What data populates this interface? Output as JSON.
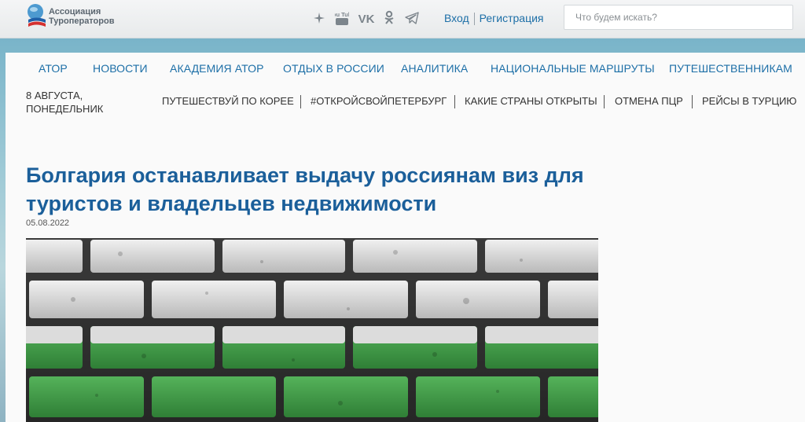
{
  "header": {
    "logo_line1": "Ассоциация",
    "logo_line2": "Туроператоров",
    "social_icons": [
      "star-icon",
      "youtube-icon",
      "vk-icon",
      "odnoklassniki-icon",
      "telegram-icon"
    ],
    "youtube_label": "You Tube",
    "vk_label": "VK",
    "login": "Вход",
    "register": "Регистрация",
    "search_placeholder": "Что будем искать?"
  },
  "nav": {
    "items": [
      "АТОР",
      "НОВОСТИ",
      "АКАДЕМИЯ АТОР",
      "ОТДЫХ В РОССИИ",
      "АНАЛИТИКА",
      "НАЦИОНАЛЬНЫЕ МАРШРУТЫ",
      "ПУТЕШЕСТВЕННИКАМ"
    ]
  },
  "date_block": {
    "line1": "8 АВГУСТА,",
    "line2": "ПОНЕДЕЛЬНИК"
  },
  "tags": [
    "ПУТЕШЕСТВУЙ ПО КОРЕЕ",
    "#ОТКРОЙСВОЙПЕТЕРБУРГ",
    "КАКИЕ СТРАНЫ ОТКРЫТЫ",
    "ОТМЕНА ПЦР",
    "РЕЙСЫ В ТУРЦИЮ"
  ],
  "article": {
    "title": "Болгария останавливает выдачу россиянам виз для туристов и владельцев недвижимости",
    "date": "05.08.2022",
    "image_subject": "brick-wall-bulgarian-flag-colors"
  },
  "colors": {
    "accent": "#1d6fa7",
    "title": "#1b5f9a",
    "flag_white": "#e9e9e9",
    "flag_green": "#3f9a45"
  }
}
